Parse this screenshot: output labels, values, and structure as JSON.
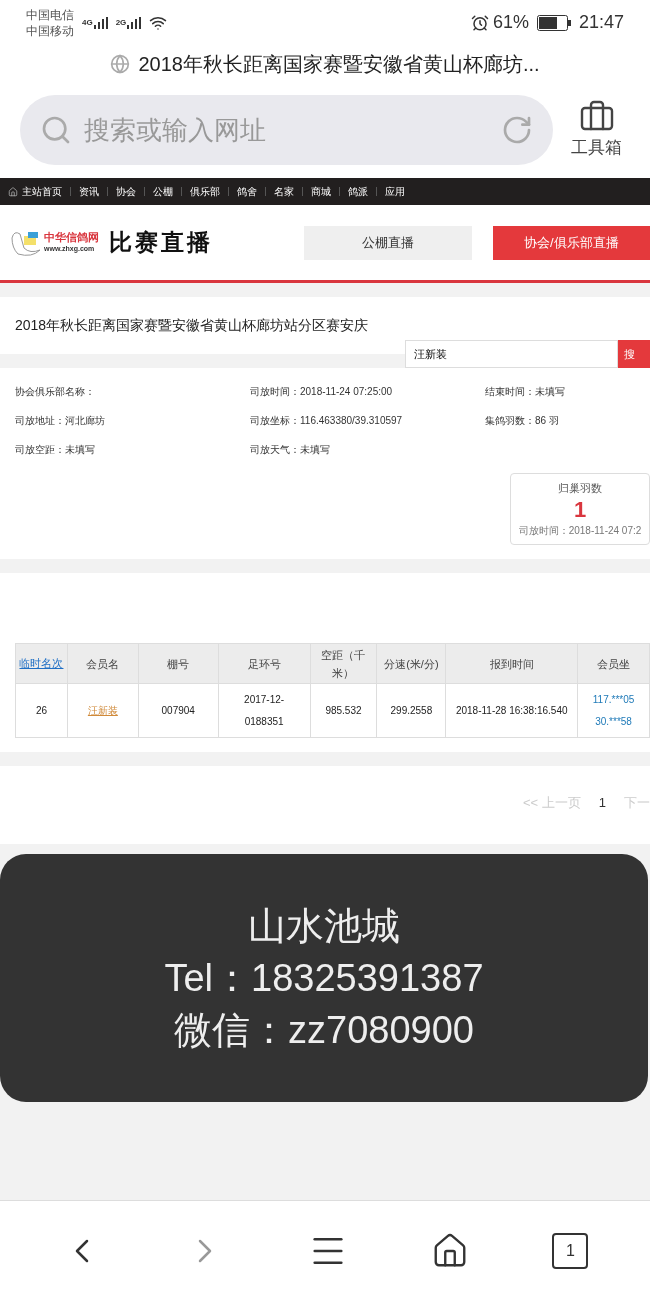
{
  "status_bar": {
    "carriers": [
      "中国电信",
      "中国移动"
    ],
    "signals": [
      "4G",
      "2G"
    ],
    "battery": "61%",
    "time": "21:47"
  },
  "page_title": "2018年秋长距离国家赛暨安徽省黄山杯廊坊...",
  "address_bar": {
    "placeholder": "搜索或输入网址"
  },
  "toolbox": {
    "label": "工具箱"
  },
  "site_nav": [
    {
      "label": "主站首页"
    },
    {
      "label": "资讯"
    },
    {
      "label": "协会"
    },
    {
      "label": "公棚"
    },
    {
      "label": "俱乐部"
    },
    {
      "label": "鸽舍"
    },
    {
      "label": "名家"
    },
    {
      "label": "商城"
    },
    {
      "label": "鸽派"
    },
    {
      "label": "应用"
    }
  ],
  "header": {
    "logo_name": "中华信鸽网",
    "logo_url": "www.zhxg.com",
    "heading": "比赛直播",
    "tabs": [
      {
        "label": "公棚直播",
        "selected": false
      },
      {
        "label": "协会/俱乐部直播",
        "selected": true
      }
    ]
  },
  "race_title": "2018年秋长距离国家赛暨安徽省黄山杯廊坊站分区赛安庆",
  "search": {
    "value": "汪新装",
    "button": "搜"
  },
  "info": [
    {
      "label": "协会俱乐部名称："
    },
    {
      "label": "司放时间：",
      "value": "2018-11-24 07:25:00"
    },
    {
      "label": "结束时间：",
      "value": "未填写"
    },
    {
      "label": "司放地址：",
      "value": "河北廊坊"
    },
    {
      "label": "司放坐标：",
      "value": "116.463380/39.310597"
    },
    {
      "label": "集鸽羽数：",
      "value": "86 羽"
    },
    {
      "label": "司放空距：",
      "value": "未填写"
    },
    {
      "label": "司放天气：",
      "value": "未填写"
    }
  ],
  "return_card": {
    "title": "归巢羽数",
    "count": "1",
    "note": "司放时间：2018-11-24 07:2"
  },
  "table": {
    "columns": [
      {
        "label": "临时名次",
        "kind": "link"
      },
      {
        "label": "会员名",
        "kind": "plain"
      },
      {
        "label": "棚号",
        "kind": "plain"
      },
      {
        "label": "足环号",
        "kind": "plain"
      },
      {
        "label": "空距（千米）",
        "kind": "plain"
      },
      {
        "label": "分速(米/分)",
        "kind": "plain"
      },
      {
        "label": "报到时间",
        "kind": "plain"
      },
      {
        "label": "会员坐",
        "kind": "plain"
      }
    ],
    "rows": [
      {
        "cells": [
          {
            "text": "26",
            "kind": "plain"
          },
          {
            "text": "汪新装",
            "kind": "member"
          },
          {
            "text": "007904",
            "kind": "plain"
          },
          {
            "text": "2017-12-\n0188351",
            "kind": "plain"
          },
          {
            "text": "985.532",
            "kind": "plain"
          },
          {
            "text": "299.2558",
            "kind": "plain"
          },
          {
            "text": "2018-11-28 16:38:16.540",
            "kind": "plain"
          },
          {
            "text": "117.***05\n30.***58",
            "kind": "coord"
          }
        ]
      }
    ]
  },
  "pager": {
    "prev": "<< 上一页",
    "current": "1",
    "next": "下一"
  },
  "overlay": {
    "lines": [
      "山水池城",
      "Tel：18325391387",
      "微信：zz7080900"
    ]
  },
  "bottom_nav": {
    "tabs_count": "1"
  }
}
